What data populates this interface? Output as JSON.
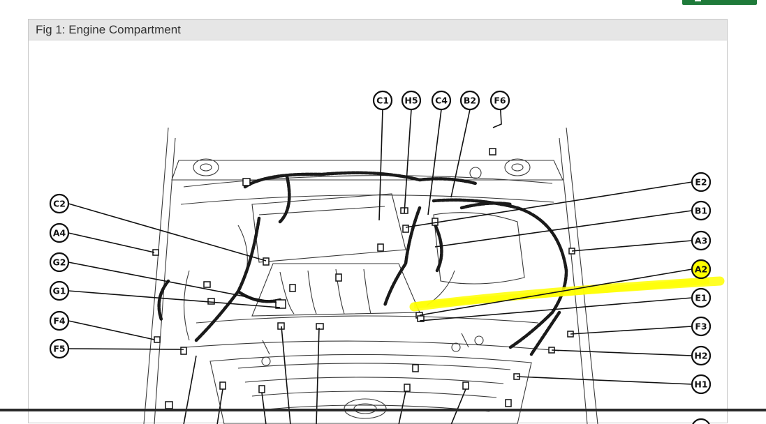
{
  "figure": {
    "title": "Fig 1: Engine Compartment"
  },
  "callouts": {
    "top": [
      "C1",
      "H5",
      "C4",
      "B2",
      "F6"
    ],
    "left": [
      "C2",
      "A4",
      "G2",
      "G1",
      "F4",
      "F5"
    ],
    "right": [
      "E2",
      "B1",
      "A3",
      "A2",
      "E1",
      "F3",
      "H2",
      "H1"
    ]
  },
  "highlight": {
    "label": "A2",
    "color": "#ffff00"
  },
  "colors": {
    "button": "#1f7a3a",
    "highlight": "#ffff00"
  }
}
